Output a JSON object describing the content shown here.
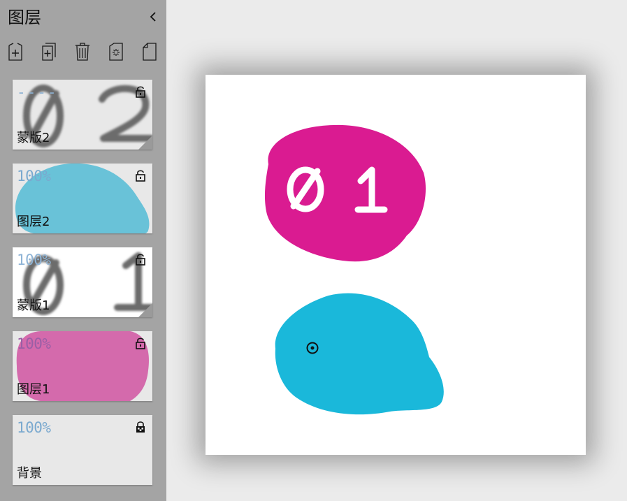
{
  "panel": {
    "title": "图层",
    "collapse_icon": "chevron-left-icon"
  },
  "toolbar": {
    "buttons": [
      {
        "icon": "add-layer-icon"
      },
      {
        "icon": "duplicate-layer-icon"
      },
      {
        "icon": "trash-icon"
      },
      {
        "icon": "clear-layer-icon"
      },
      {
        "icon": "copy-page-icon"
      }
    ]
  },
  "layers": [
    {
      "name": "蒙版2",
      "opacity": "----",
      "thumb_text": "0 2",
      "type": "mask",
      "locked": false
    },
    {
      "name": "图层2",
      "opacity": "100%",
      "color": "#69c2d8",
      "type": "layer",
      "locked": false
    },
    {
      "name": "蒙版1",
      "opacity": "100%",
      "thumb_text": "0 1",
      "type": "mask",
      "locked": false
    },
    {
      "name": "图层1",
      "opacity": "100%",
      "color": "#d46aac",
      "type": "layer",
      "locked": false
    },
    {
      "name": "背景",
      "opacity": "100%",
      "type": "background",
      "locked": true
    }
  ],
  "canvas": {
    "background": "#ffffff",
    "magenta": "#da1b91",
    "cyan": "#1ab8da",
    "blob_text": "0 1"
  }
}
